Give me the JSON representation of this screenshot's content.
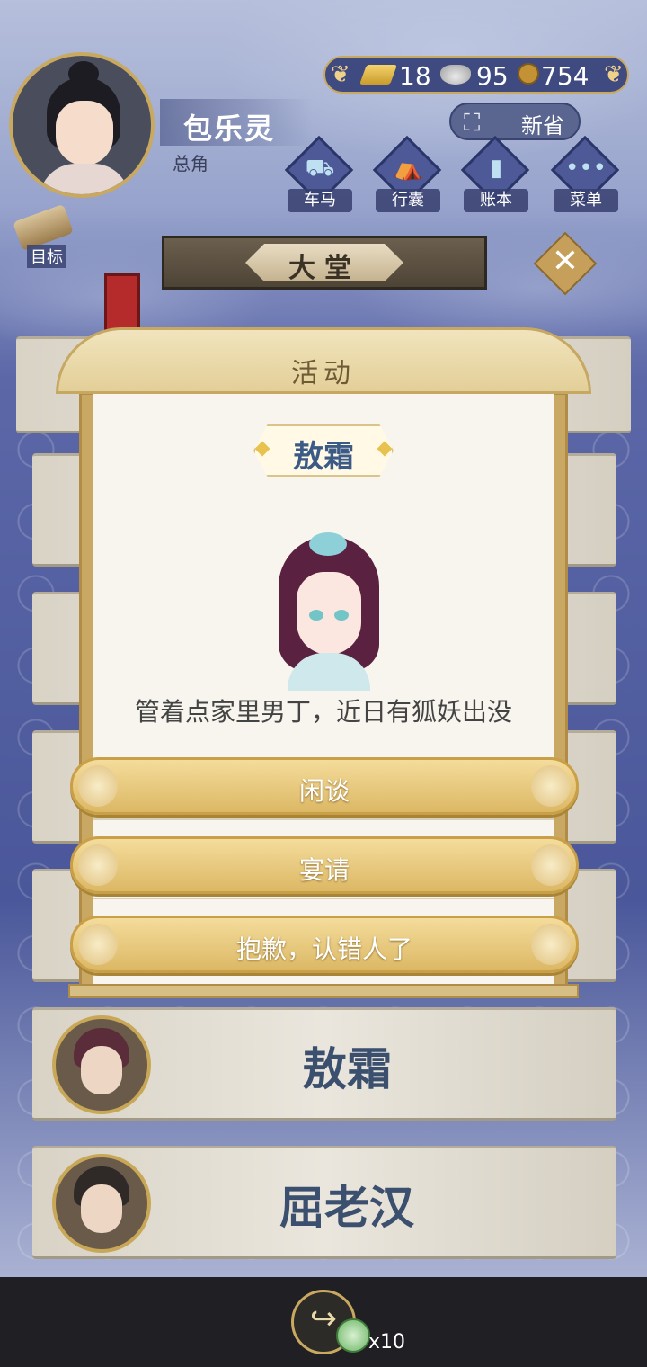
{
  "header": {
    "player_name": "包乐灵",
    "player_rank": "总角",
    "province_label": "新省"
  },
  "resources": {
    "gold": "18",
    "silver": "95",
    "coins": "754"
  },
  "menu": [
    {
      "label": "车马",
      "icon": "carriage-icon"
    },
    {
      "label": "行囊",
      "icon": "bag-icon"
    },
    {
      "label": "账本",
      "icon": "ledger-icon"
    },
    {
      "label": "菜单",
      "icon": "more-icon"
    }
  ],
  "goal": {
    "label": "目标"
  },
  "hall": {
    "title": "大堂"
  },
  "list": [
    {
      "name": "敖霜"
    },
    {
      "name": "屈老汉"
    }
  ],
  "dialog": {
    "title": "活动",
    "npc_name": "敖霜",
    "quote": "管着点家里男丁，近日有狐妖出没",
    "choices": [
      "闲谈",
      "宴请",
      "抱歉，认错人了"
    ]
  },
  "bottom": {
    "jade_count": "x10"
  },
  "colors": {
    "accent_gold": "#c9a860",
    "navy": "#3f4a80",
    "name_blue": "#3b5a86"
  }
}
